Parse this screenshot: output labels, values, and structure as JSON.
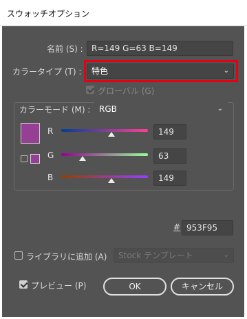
{
  "window": {
    "title": "スウォッチオプション"
  },
  "name": {
    "label": "名前 (S) :",
    "value": "R=149 G=63 B=149"
  },
  "color_type": {
    "label": "カラータイプ (T) :",
    "value": "特色"
  },
  "global": {
    "label": "グローバル (G)",
    "checked": true,
    "enabled": false
  },
  "color_mode": {
    "label": "カラーモード (M) :",
    "value": "RGB"
  },
  "swatch": {
    "color": "#953F95"
  },
  "channels": [
    {
      "name": "R",
      "value": "149",
      "level": 0.584
    },
    {
      "name": "G",
      "value": "63",
      "level": 0.247
    },
    {
      "name": "B",
      "value": "149",
      "level": 0.584
    }
  ],
  "hex": {
    "label": "#",
    "value": "953F95"
  },
  "library": {
    "label": "ライブラリに追加 (A)",
    "checked": false,
    "select_value": "Stock テンプレート"
  },
  "preview": {
    "label": "プレビュー (P)",
    "checked": true
  },
  "buttons": {
    "ok": "OK",
    "cancel": "キャンセル"
  },
  "colors": {
    "panel": "#535353",
    "highlight": "#e60012",
    "swatch": "#953F95"
  }
}
